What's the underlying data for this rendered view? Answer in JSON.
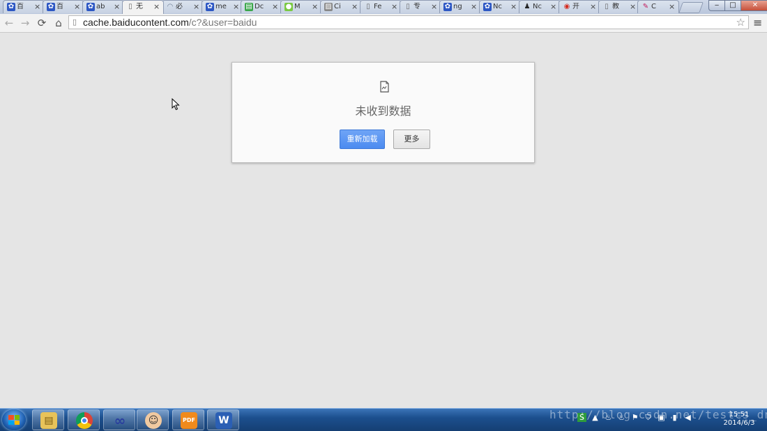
{
  "tabs": [
    {
      "title": "百",
      "icon": "baidu-paw-icon"
    },
    {
      "title": "百",
      "icon": "baidu-paw-icon"
    },
    {
      "title": "ab",
      "icon": "baidu-paw-icon"
    },
    {
      "title": "无",
      "icon": "page-icon",
      "active": true
    },
    {
      "title": "必",
      "icon": "loading-spinner-icon"
    },
    {
      "title": "me",
      "icon": "baidu-paw-icon"
    },
    {
      "title": "Dc",
      "icon": "green-doc-icon"
    },
    {
      "title": "M",
      "icon": "lime-circle-icon"
    },
    {
      "title": "Ci",
      "icon": "striped-icon"
    },
    {
      "title": "Fe",
      "icon": "page-icon"
    },
    {
      "title": "专",
      "icon": "page-icon"
    },
    {
      "title": "ng",
      "icon": "baidu-paw-icon"
    },
    {
      "title": "Nc",
      "icon": "baidu-paw-icon"
    },
    {
      "title": "Nc",
      "icon": "penguin-icon"
    },
    {
      "title": "开",
      "icon": "weibo-icon"
    },
    {
      "title": "教",
      "icon": "page-icon"
    },
    {
      "title": "C",
      "icon": "pen-icon"
    }
  ],
  "toolbar": {
    "url_host": "cache.baiducontent.com",
    "url_path": "/c?&user=baidu"
  },
  "error": {
    "icon": "broken-page-icon",
    "title": "未收到数据",
    "reload_label": "重新加载",
    "more_label": "更多"
  },
  "taskbar": {
    "apps": [
      "file-explorer-icon",
      "chrome-icon",
      "infinity-app-icon",
      "avatar-app-icon",
      "pdf-icon",
      "word-icon"
    ],
    "time": "15:51",
    "date": "2014/6/3"
  },
  "watermark": "http://blog.csdn.net/testcs_dn",
  "colors": {
    "reload_button": "#4c8bf0",
    "page_background": "#e5e5e5"
  }
}
